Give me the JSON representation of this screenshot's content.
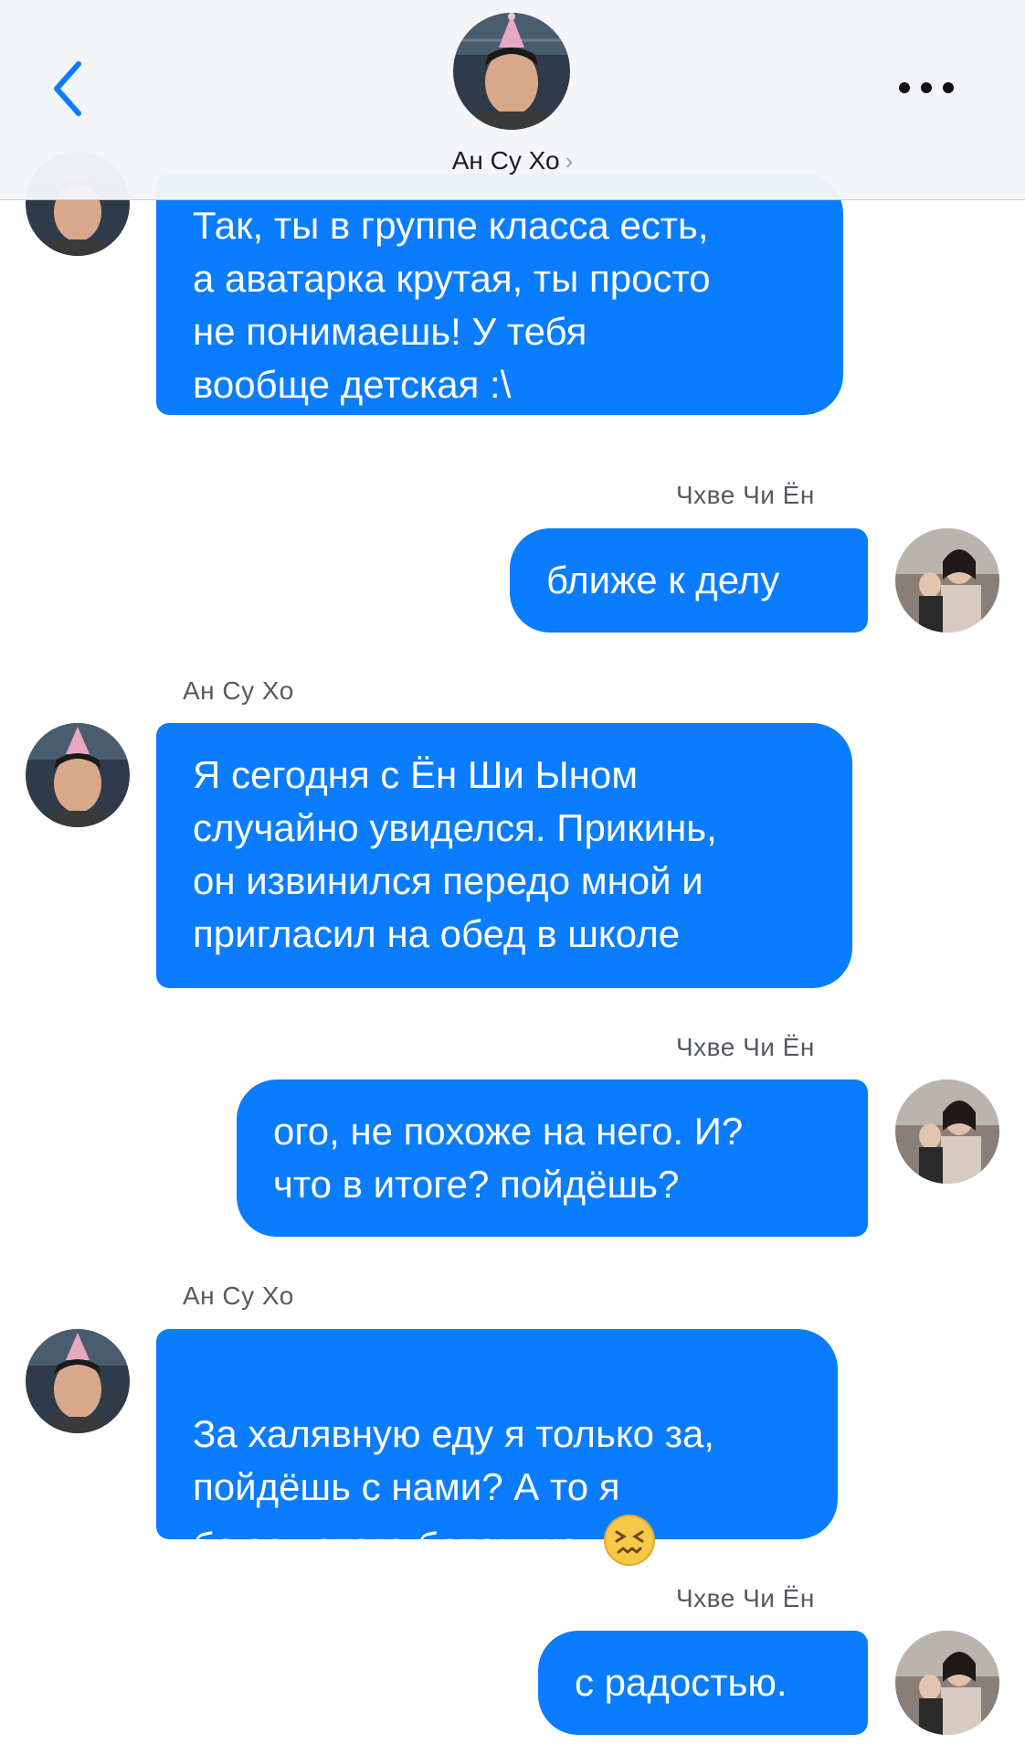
{
  "header": {
    "contact_name": "Ан Су Хо",
    "chevron": "›",
    "back_icon": "chevron-left",
    "more_icon": "ellipsis"
  },
  "colors": {
    "bubble": "#0a7cff",
    "header_bg": "#f3f5f8",
    "accent": "#0a7cff"
  },
  "messages": [
    {
      "sender": "",
      "direction": "in",
      "text": "Так, ты в группе класса есть,\nа аватарка крутая, ты просто\nне понимаешь! У тебя\nвообще детская :\\"
    },
    {
      "sender": "Чхве Чи Ён",
      "direction": "out",
      "text": "ближе к делу"
    },
    {
      "sender": "Ан Су Хо",
      "direction": "in",
      "text": "Я сегодня с Ён Ши Ыном\nслучайно увиделся. Прикинь,\nон извинился передо мной и\nпригласил на обед в школе"
    },
    {
      "sender": "Чхве Чи Ён",
      "direction": "out",
      "text": "ого, не похоже на него. И?\nчто в итоге? пойдёшь?"
    },
    {
      "sender": "Ан Су Хо",
      "direction": "in",
      "text": "За халявную еду я только за,\nпойдёшь с нами? А то я\nбоюсь этого ботаника..",
      "emoji": "confounded-face"
    },
    {
      "sender": "Чхве Чи Ён",
      "direction": "out",
      "text": "с радостью."
    }
  ]
}
